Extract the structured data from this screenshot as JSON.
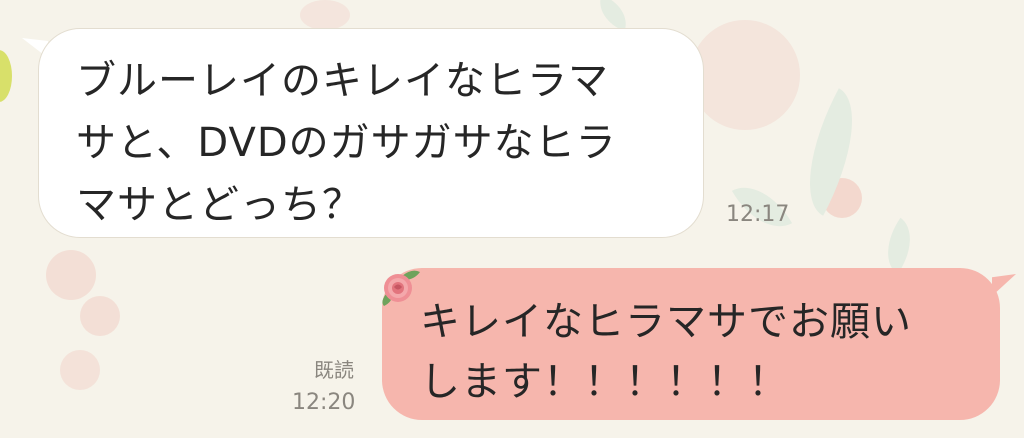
{
  "chat": {
    "messages": [
      {
        "direction": "incoming",
        "text": "ブルーレイのキレイなヒラマ\nサと、DVDのガサガサなヒラ\nマサとどっち？",
        "time": "12:17"
      },
      {
        "direction": "outgoing",
        "text": "キレイなヒラマサでお願い\nします！！！！！！",
        "read_status": "既読",
        "time": "12:20"
      }
    ]
  },
  "colors": {
    "background": "#f6f3ea",
    "incoming_bubble": "#ffffff",
    "outgoing_bubble": "#f6b6ad",
    "text": "#262626",
    "timestamp": "#8a867f"
  },
  "icons": {
    "sticker": "pink-rose-icon"
  }
}
